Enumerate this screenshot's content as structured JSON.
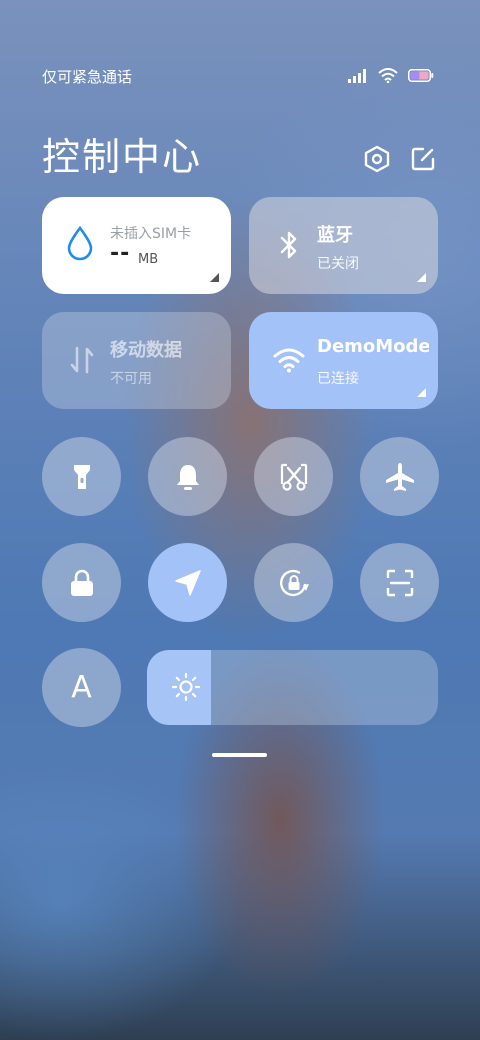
{
  "status_bar": {
    "carrier": "仅可紧急通话"
  },
  "header": {
    "title": "控制中心",
    "settings_icon": "settings-hexagon-icon",
    "edit_icon": "edit-icon"
  },
  "tiles": {
    "data_usage": {
      "label": "未插入SIM卡",
      "value": "--",
      "unit": "MB",
      "icon": "water-drop-icon",
      "accent": "#1e8cf0"
    },
    "bluetooth": {
      "label": "蓝牙",
      "status": "已关闭",
      "icon": "bluetooth-icon"
    },
    "mobile_data": {
      "label": "移动数据",
      "status": "不可用",
      "icon": "mobile-data-arrows-icon"
    },
    "wifi": {
      "label": "DemoMode",
      "status": "已连接",
      "icon": "wifi-icon",
      "accent": "#a3c2f7"
    }
  },
  "toggles_row1": [
    {
      "icon": "flashlight-icon",
      "active": false
    },
    {
      "icon": "bell-icon",
      "active": false
    },
    {
      "icon": "screenshot-scissors-icon",
      "active": false
    },
    {
      "icon": "airplane-icon",
      "active": false
    }
  ],
  "toggles_row2": [
    {
      "icon": "lock-icon",
      "active": false
    },
    {
      "icon": "location-icon",
      "active": true
    },
    {
      "icon": "rotation-lock-icon",
      "active": false
    },
    {
      "icon": "scan-icon",
      "active": false
    }
  ],
  "brightness": {
    "icon": "sun-icon",
    "level_fraction": 0.22
  },
  "auto_brightness": {
    "label": "A"
  }
}
